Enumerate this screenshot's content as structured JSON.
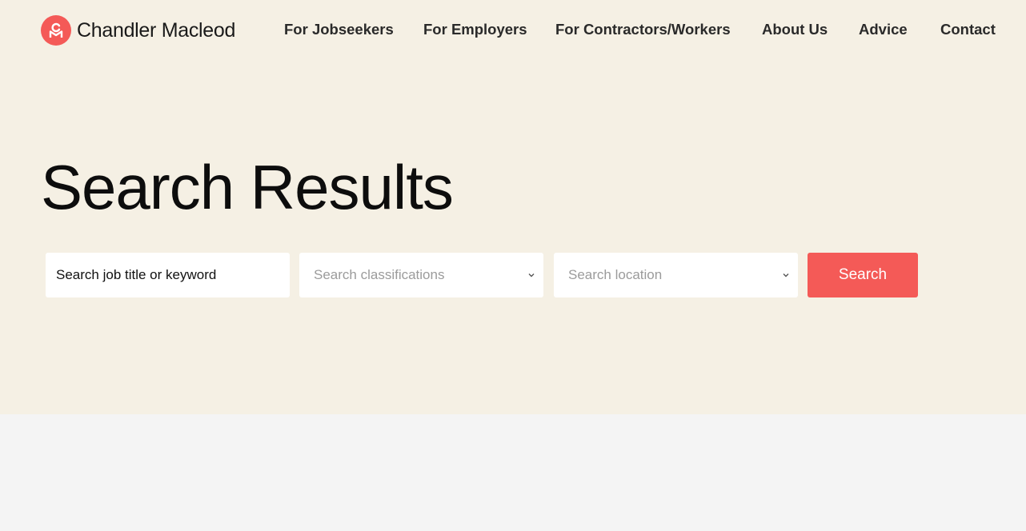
{
  "brand": {
    "name": "Chandler Macleod",
    "accent_color": "#f45a57",
    "logo_icon": "cm-monogram-icon"
  },
  "nav": {
    "items": [
      {
        "label": "For Jobseekers"
      },
      {
        "label": "For Employers"
      },
      {
        "label": "For Contractors/Workers"
      },
      {
        "label": "About Us"
      },
      {
        "label": "Advice"
      },
      {
        "label": "Contact"
      }
    ]
  },
  "hero": {
    "title": "Search Results",
    "background_color": "#f5f0e4"
  },
  "search": {
    "keyword_placeholder": "Search job title or keyword",
    "classification_placeholder": "Search classifications",
    "location_placeholder": "Search location",
    "button_label": "Search",
    "dropdown_icon": "chevron-down-icon"
  },
  "lower_section": {
    "background_color": "#f4f4f4"
  }
}
